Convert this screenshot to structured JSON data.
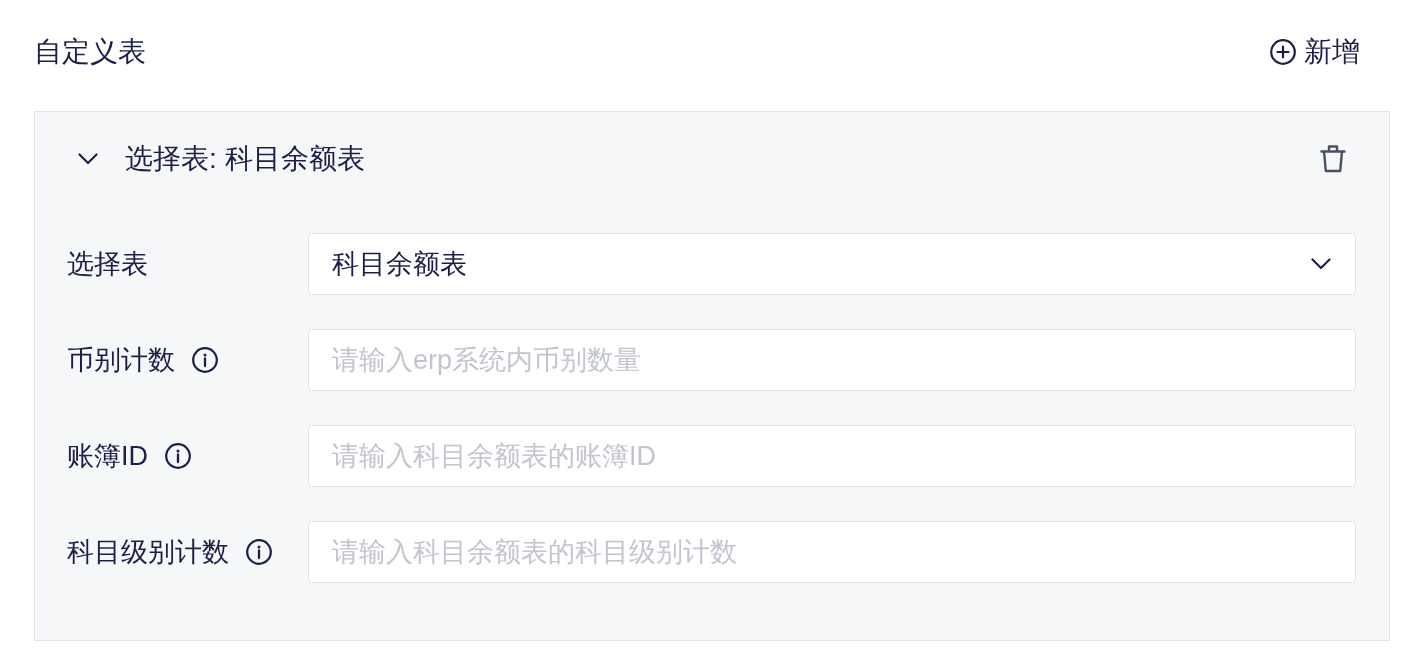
{
  "title": "自定义表",
  "add_button": {
    "label": "新增"
  },
  "tables": [
    {
      "header": "选择表: 科目余额表",
      "expanded": true,
      "fields": [
        {
          "kind": "select",
          "label": "选择表",
          "info": false,
          "value": "科目余额表"
        },
        {
          "kind": "input",
          "label": "币别计数",
          "info": true,
          "placeholder": "请输入erp系统内币别数量"
        },
        {
          "kind": "input",
          "label": "账簿ID",
          "info": true,
          "placeholder": "请输入科目余额表的账簿ID"
        },
        {
          "kind": "input",
          "label": "科目级别计数",
          "info": true,
          "placeholder": "请输入科目余额表的科目级别计数"
        }
      ]
    }
  ]
}
